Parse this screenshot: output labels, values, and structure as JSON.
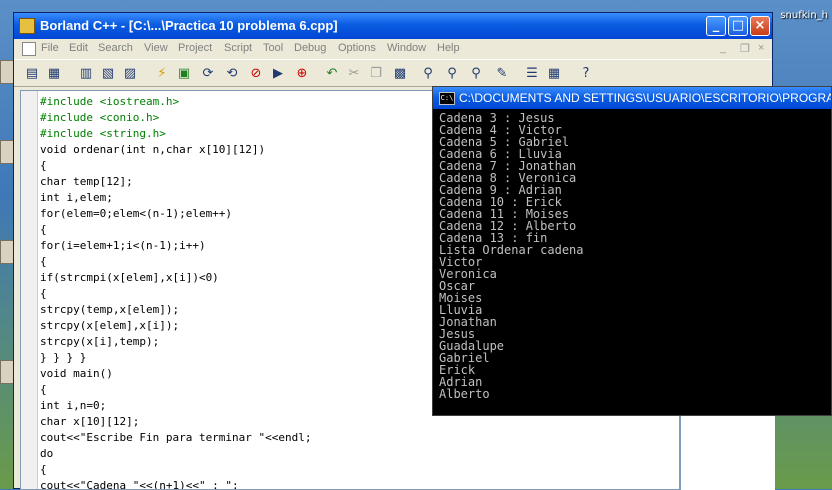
{
  "desktop": {
    "label_right": "snufkin_h"
  },
  "window": {
    "title": "Borland C++ - [C:\\...\\Practica 10 problema 6.cpp]",
    "minimize": "_",
    "maximize": "□",
    "close": "×"
  },
  "menu": {
    "items": [
      "File",
      "Edit",
      "Search",
      "View",
      "Project",
      "Script",
      "Tool",
      "Debug",
      "Options",
      "Window",
      "Help"
    ],
    "mdi_min": "_",
    "mdi_restore": "❐",
    "mdi_close": "×"
  },
  "code_lines": [
    "#include <iostream.h>",
    "#include <conio.h>",
    "#include <string.h>",
    "void ordenar(int n,char x[10][12])",
    "{",
    "char temp[12];",
    "int i,elem;",
    "for(elem=0;elem<(n-1);elem++)",
    "{",
    "for(i=elem+1;i<(n-1);i++)",
    "{",
    "if(strcmpi(x[elem],x[i])<0)",
    "{",
    "strcpy(temp,x[elem]);",
    "strcpy(x[elem],x[i]);",
    "strcpy(x[i],temp);",
    "} } } }",
    "void main()",
    "{",
    "int i,n=0;",
    "char x[10][12];",
    "cout<<\"Escribe Fin para terminar \"<<endl;",
    "do",
    "{",
    "cout<<\"Cadena \"<<(n+1)<<\" : \";"
  ],
  "console": {
    "title": "C:\\DOCUMENTS AND SETTINGS\\USUARIO\\ESCRITORIO\\PROGRA",
    "icon": "C:\\",
    "lines": [
      "Cadena 3 : Jesus",
      "Cadena 4 : Victor",
      "Cadena 5 : Gabriel",
      "Cadena 6 : Lluvia",
      "Cadena 7 : Jonathan",
      "Cadena 8 : Veronica",
      "Cadena 9 : Adrian",
      "Cadena 10 : Erick",
      "Cadena 11 : Moises",
      "Cadena 12 : Alberto",
      "Cadena 13 : fin",
      "Lista Ordenar cadena",
      "Victor",
      "Veronica",
      "Oscar",
      "Moises",
      "Lluvia",
      "Jonathan",
      "Jesus",
      "Guadalupe",
      "Gabriel",
      "Erick",
      "Adrian",
      "Alberto"
    ]
  },
  "toolbar_icons": [
    "project-new-icon",
    "project-open-icon",
    "file-new-icon",
    "file-open-icon",
    "file-save-icon",
    "compile-icon",
    "make-icon",
    "debug-icon",
    "step-icon",
    "stop-icon",
    "run-icon",
    "browse-icon",
    "undo-icon",
    "cut-icon",
    "copy-icon",
    "paste-icon",
    "find-icon",
    "replace-icon",
    "search-next-icon",
    "bookmark-icon",
    "window-icon",
    "tile-icon",
    "help-icon"
  ]
}
